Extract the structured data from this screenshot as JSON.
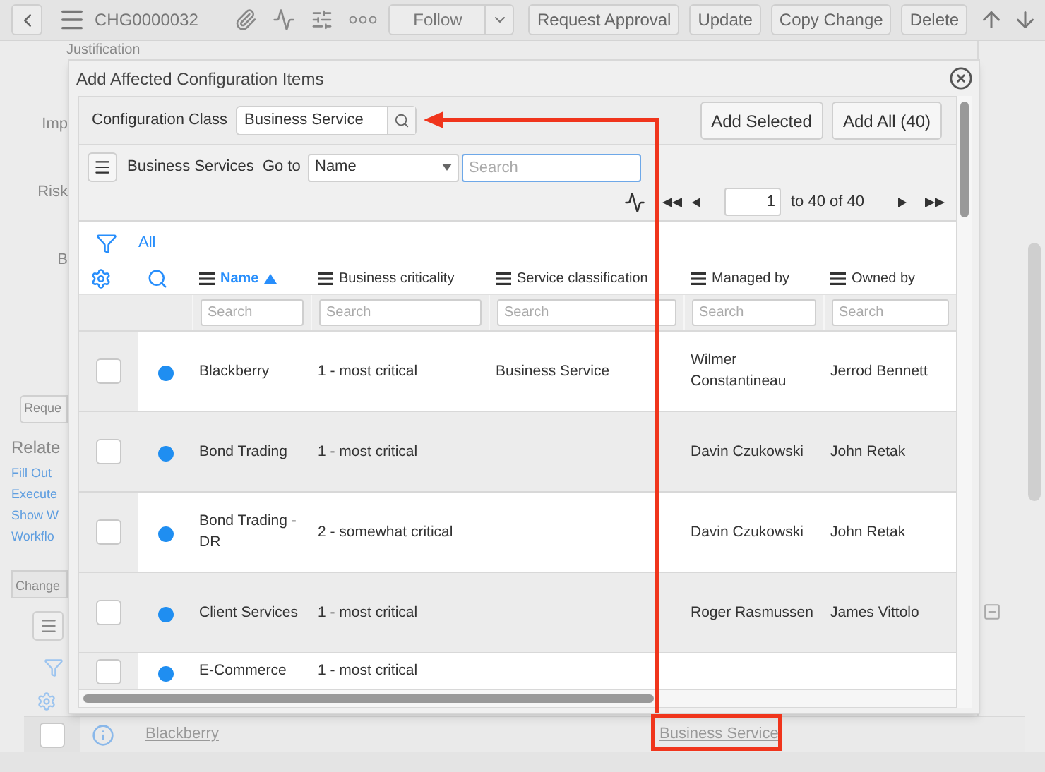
{
  "top_bar": {
    "record_number": "CHG0000032",
    "follow_button": "Follow",
    "buttons": [
      "Request Approval",
      "Update",
      "Copy Change",
      "Delete"
    ]
  },
  "background_form": {
    "field_labels": [
      "Justification",
      "Imp",
      "Risk",
      "B"
    ],
    "button": "Reque",
    "related_heading": "Relate",
    "related_links": [
      "Fill Out",
      "Execute",
      "Show W",
      "Workflo"
    ],
    "tab": "Change",
    "row": {
      "checked": false,
      "name": "Blackberry",
      "class": "Business Service"
    }
  },
  "dialog": {
    "title": "Add Affected Configuration Items",
    "class_label": "Configuration Class",
    "class_value": "Business Service",
    "buttons": [
      "Add Selected",
      "Add All (40)"
    ],
    "list_title": "Business Services",
    "goto_label": "Go to",
    "goto_field": "Name",
    "search_placeholder": "Search",
    "page": "1",
    "page_total": "to 40 of 40",
    "filter": "All",
    "columns": [
      {
        "label": "Name",
        "sorted": true,
        "search_placeholder": "Search"
      },
      {
        "label": "Business criticality",
        "sorted": false,
        "search_placeholder": "Search"
      },
      {
        "label": "Service classification",
        "sorted": false,
        "search_placeholder": "Search"
      },
      {
        "label": "Managed by",
        "sorted": false,
        "search_placeholder": "Search"
      },
      {
        "label": "Owned by",
        "sorted": false,
        "search_placeholder": "Search"
      }
    ],
    "rows": [
      {
        "checked": false,
        "color": "#1f8ef1",
        "cells": [
          "Blackberry",
          "1 - most critical",
          "Business Service",
          "Wilmer Constantineau",
          "Jerrod Bennett"
        ]
      },
      {
        "checked": false,
        "color": "#1f8ef1",
        "cells": [
          "Bond Trading",
          "1 - most critical",
          "",
          "Davin Czukowski",
          "John Retak"
        ]
      },
      {
        "checked": false,
        "color": "#1f8ef1",
        "cells": [
          "Bond Trading - DR",
          "2 - somewhat critical",
          "",
          "Davin Czukowski",
          "John Retak"
        ]
      },
      {
        "checked": false,
        "color": "#1f8ef1",
        "cells": [
          "Client Services",
          "1 - most critical",
          "",
          "Roger Rasmussen",
          "James Vittolo"
        ]
      },
      {
        "checked": false,
        "color": "#1f8ef1",
        "cells": [
          "E-Commerce",
          "1 - most critical",
          "",
          "",
          ""
        ]
      }
    ]
  }
}
